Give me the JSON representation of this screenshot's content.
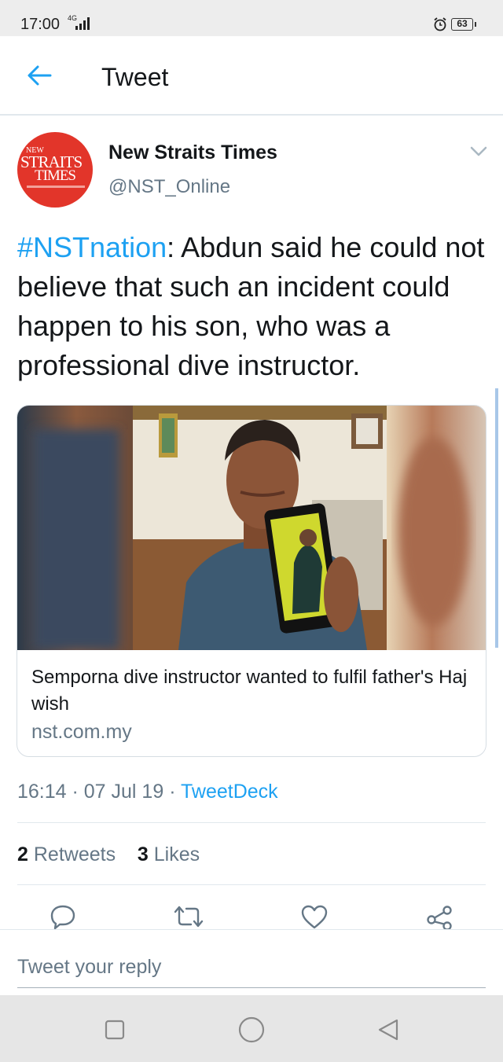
{
  "status_bar": {
    "time": "17:00",
    "network": "4G",
    "battery": "63",
    "icons": [
      "signal-icon",
      "alarm-icon",
      "battery-icon"
    ]
  },
  "header": {
    "title": "Tweet",
    "back_icon": "arrow-left-icon"
  },
  "tweet": {
    "author": {
      "name": "New Straits Times",
      "handle": "@NST_Online",
      "avatar_lines": [
        "NEW",
        "STRAITS",
        "TIMES"
      ]
    },
    "hashtag": "#NSTnation",
    "text": ": Abdun said he could not believe that such an incident could happen to his son, who was a professional dive instructor.",
    "card": {
      "title": "Semporna dive instructor wanted to fulfil father's Haj wish",
      "domain": "nst.com.my"
    },
    "timestamp": "16:14 · 07 Jul 19 · ",
    "source": "TweetDeck",
    "stats": {
      "retweets_count": "2",
      "retweets_label": "Retweets",
      "likes_count": "3",
      "likes_label": "Likes"
    },
    "actions": [
      "reply-icon",
      "retweet-icon",
      "like-icon",
      "share-icon"
    ]
  },
  "reply": {
    "placeholder": "Tweet your reply"
  },
  "colors": {
    "accent": "#1da1f2",
    "secondary_text": "#657786",
    "avatar_red": "#e2352a"
  }
}
